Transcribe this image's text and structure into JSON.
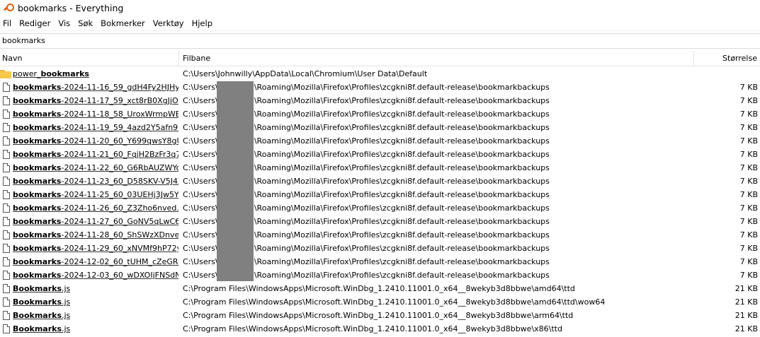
{
  "window": {
    "title": "bookmarks - Everything"
  },
  "menu": [
    "Fil",
    "Rediger",
    "Vis",
    "Søk",
    "Bokmerker",
    "Verktøy",
    "Hjelp"
  ],
  "search": {
    "value": "bookmarks"
  },
  "columns": {
    "name": "Navn",
    "path": "Filbane",
    "size": "Størrelse"
  },
  "rows": [
    {
      "type": "folder",
      "pre": "power_",
      "bold": "bookmarks",
      "post": "",
      "path": "C:\\Users\\Johnwilly\\AppData\\Local\\Chromium\\User Data\\Default",
      "size": ""
    },
    {
      "type": "file",
      "pre": "",
      "bold": "bookmarks",
      "post": "-2024-11-16_59_gdH4Fy2HJHy...",
      "path": "C:\\Users\\           AppData\\Roaming\\Mozilla\\Firefox\\Profiles\\zcgkni8f.default-release\\bookmarkbackups",
      "size": "7 KB"
    },
    {
      "type": "file",
      "pre": "",
      "bold": "bookmarks",
      "post": "-2024-11-17_59_xct8rB0XgJjOs...",
      "path": "C:\\Users\\           AppData\\Roaming\\Mozilla\\Firefox\\Profiles\\zcgkni8f.default-release\\bookmarkbackups",
      "size": "7 KB"
    },
    {
      "type": "file",
      "pre": "",
      "bold": "bookmarks",
      "post": "-2024-11-18_58_UroxWrmpWB...",
      "path": "C:\\Users\\           AppData\\Roaming\\Mozilla\\Firefox\\Profiles\\zcgkni8f.default-release\\bookmarkbackups",
      "size": "7 KB"
    },
    {
      "type": "file",
      "pre": "",
      "bold": "bookmarks",
      "post": "-2024-11-19_59_4azd2Y5afn9N...",
      "path": "C:\\Users\\           AppData\\Roaming\\Mozilla\\Firefox\\Profiles\\zcgkni8f.default-release\\bookmarkbackups",
      "size": "7 KB"
    },
    {
      "type": "file",
      "pre": "",
      "bold": "bookmarks",
      "post": "-2024-11-20_60_Y699qwsY8gU...",
      "path": "C:\\Users\\           AppData\\Roaming\\Mozilla\\Firefox\\Profiles\\zcgkni8f.default-release\\bookmarkbackups",
      "size": "7 KB"
    },
    {
      "type": "file",
      "pre": "",
      "bold": "bookmarks",
      "post": "-2024-11-21_60_FqjH2BzFr3q7...",
      "path": "C:\\Users\\           AppData\\Roaming\\Mozilla\\Firefox\\Profiles\\zcgkni8f.default-release\\bookmarkbackups",
      "size": "7 KB"
    },
    {
      "type": "file",
      "pre": "",
      "bold": "bookmarks",
      "post": "-2024-11-22_60_G6RbAUZWYo...",
      "path": "C:\\Users\\           AppData\\Roaming\\Mozilla\\Firefox\\Profiles\\zcgkni8f.default-release\\bookmarkbackups",
      "size": "7 KB"
    },
    {
      "type": "file",
      "pre": "",
      "bold": "bookmarks",
      "post": "-2024-11-23_60_D58SKV-V5J4Z...",
      "path": "C:\\Users\\           AppData\\Roaming\\Mozilla\\Firefox\\Profiles\\zcgkni8f.default-release\\bookmarkbackups",
      "size": "7 KB"
    },
    {
      "type": "file",
      "pre": "",
      "bold": "bookmarks",
      "post": "-2024-11-25_60_03UEHj3Jw5YI...",
      "path": "C:\\Users\\           AppData\\Roaming\\Mozilla\\Firefox\\Profiles\\zcgkni8f.default-release\\bookmarkbackups",
      "size": "7 KB"
    },
    {
      "type": "file",
      "pre": "",
      "bold": "bookmarks",
      "post": "-2024-11-26_60_Z3Zho6nved...",
      "path": "C:\\Users\\           AppData\\Roaming\\Mozilla\\Firefox\\Profiles\\zcgkni8f.default-release\\bookmarkbackups",
      "size": "7 KB"
    },
    {
      "type": "file",
      "pre": "",
      "bold": "bookmarks",
      "post": "-2024-11-27_60_GoNV5qLwC6...",
      "path": "C:\\Users\\           AppData\\Roaming\\Mozilla\\Firefox\\Profiles\\zcgkni8f.default-release\\bookmarkbackups",
      "size": "7 KB"
    },
    {
      "type": "file",
      "pre": "",
      "bold": "bookmarks",
      "post": "-2024-11-28_60_ShSWzXDnveS...",
      "path": "C:\\Users\\           AppData\\Roaming\\Mozilla\\Firefox\\Profiles\\zcgkni8f.default-release\\bookmarkbackups",
      "size": "7 KB"
    },
    {
      "type": "file",
      "pre": "",
      "bold": "bookmarks",
      "post": "-2024-11-29_60_xNVMf9hP72y...",
      "path": "C:\\Users\\           AppData\\Roaming\\Mozilla\\Firefox\\Profiles\\zcgkni8f.default-release\\bookmarkbackups",
      "size": "7 KB"
    },
    {
      "type": "file",
      "pre": "",
      "bold": "bookmarks",
      "post": "-2024-12-02_60_tUHM_cZeGR...",
      "path": "C:\\Users\\           AppData\\Roaming\\Mozilla\\Firefox\\Profiles\\zcgkni8f.default-release\\bookmarkbackups",
      "size": "7 KB"
    },
    {
      "type": "file",
      "pre": "",
      "bold": "bookmarks",
      "post": "-2024-12-03_60_wDXOIjFNSdN...",
      "path": "C:\\Users\\           AppData\\Roaming\\Mozilla\\Firefox\\Profiles\\zcgkni8f.default-release\\bookmarkbackups",
      "size": "7 KB"
    },
    {
      "type": "file",
      "pre": "",
      "bold": "Bookmarks",
      "post": ".js",
      "path": "C:\\Program Files\\WindowsApps\\Microsoft.WinDbg_1.2410.11001.0_x64__8wekyb3d8bbwe\\amd64\\ttd",
      "size": "21 KB"
    },
    {
      "type": "file",
      "pre": "",
      "bold": "Bookmarks",
      "post": ".js",
      "path": "C:\\Program Files\\WindowsApps\\Microsoft.WinDbg_1.2410.11001.0_x64__8wekyb3d8bbwe\\amd64\\ttd\\wow64",
      "size": "21 KB"
    },
    {
      "type": "file",
      "pre": "",
      "bold": "Bookmarks",
      "post": ".js",
      "path": "C:\\Program Files\\WindowsApps\\Microsoft.WinDbg_1.2410.11001.0_x64__8wekyb3d8bbwe\\arm64\\ttd",
      "size": "21 KB"
    },
    {
      "type": "file",
      "pre": "",
      "bold": "Bookmarks",
      "post": ".js",
      "path": "C:\\Program Files\\WindowsApps\\Microsoft.WinDbg_1.2410.11001.0_x64__8wekyb3d8bbwe\\x86\\ttd",
      "size": "21 KB"
    }
  ],
  "colors": {
    "folder": "#f5c84c",
    "app_icon": "#e2620e",
    "redaction": "#808080"
  }
}
